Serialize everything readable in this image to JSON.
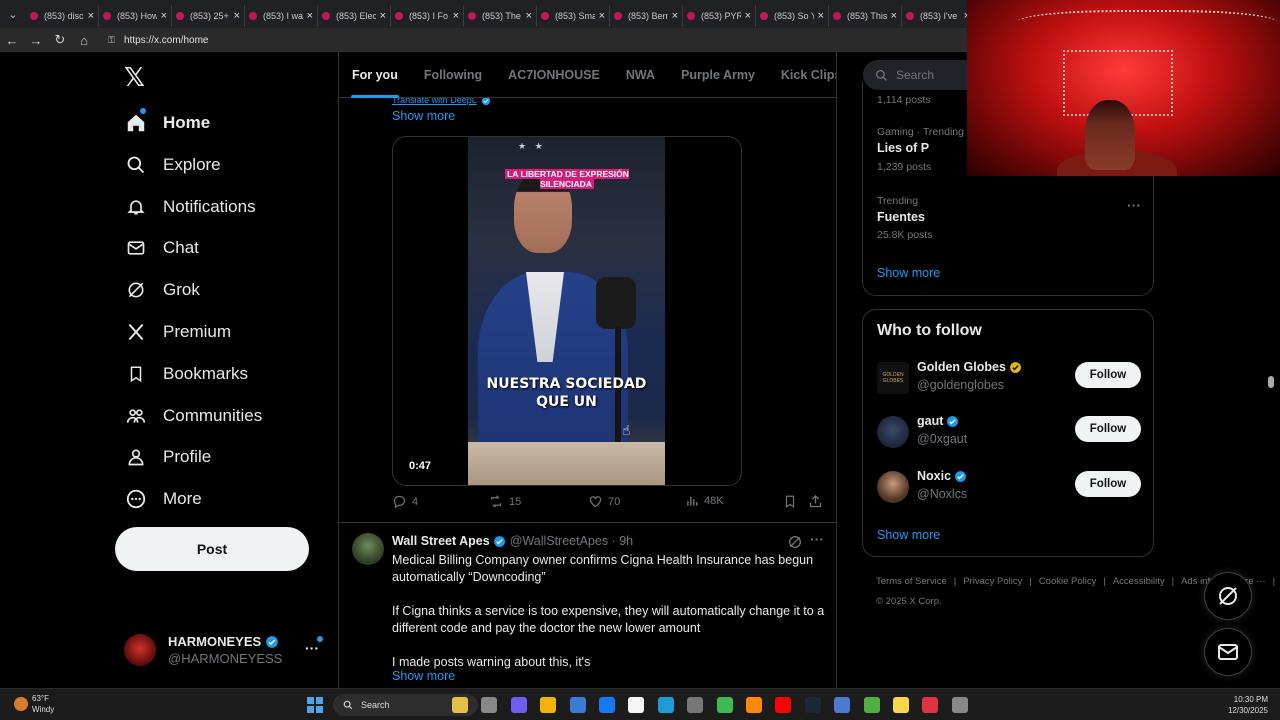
{
  "browser": {
    "tabs": [
      {
        "title": "(853) disc"
      },
      {
        "title": "(853) How"
      },
      {
        "title": "(853) 25+"
      },
      {
        "title": "(853) I wa"
      },
      {
        "title": "(853) Elec"
      },
      {
        "title": "(853) I Fo"
      },
      {
        "title": "(853) The"
      },
      {
        "title": "(853) Sma"
      },
      {
        "title": "(853) Bern"
      },
      {
        "title": "(853) PYR"
      },
      {
        "title": "(853) So Y"
      },
      {
        "title": "(853) This"
      },
      {
        "title": "(853) I've"
      }
    ],
    "tab_close": "×",
    "url": "https://x.com/home"
  },
  "nav": {
    "logo": "𝕏",
    "items": [
      {
        "label": "Home",
        "icon": "home-icon"
      },
      {
        "label": "Explore",
        "icon": "search-icon"
      },
      {
        "label": "Notifications",
        "icon": "bell-icon"
      },
      {
        "label": "Chat",
        "icon": "mail-icon"
      },
      {
        "label": "Grok",
        "icon": "grok-icon"
      },
      {
        "label": "Premium",
        "icon": "x-icon"
      },
      {
        "label": "Bookmarks",
        "icon": "bookmark-icon"
      },
      {
        "label": "Communities",
        "icon": "people-icon"
      },
      {
        "label": "Profile",
        "icon": "person-icon"
      },
      {
        "label": "More",
        "icon": "more-circle-icon"
      }
    ],
    "post_label": "Post",
    "account": {
      "display_name": "HARMONEYES",
      "handle": "@HARMONEYESS",
      "more": "···"
    }
  },
  "feed": {
    "tabs": [
      "For you",
      "Following",
      "AC7IONHOUSE",
      "NWA",
      "Purple Army",
      "Kick Clips"
    ],
    "tweet1": {
      "translate": "Translate with DeepL",
      "show_more": "Show more",
      "video": {
        "caption_top": "LA LIBERTAD DE EXPRESIÓN SILENCIADA",
        "stars": "★  ★",
        "subtitle_line1": "NUESTRA SOCIEDAD",
        "subtitle_line2": "QUE UN",
        "duration": "0:47"
      },
      "stats": {
        "replies": "4",
        "reposts": "15",
        "likes": "70",
        "views": "48K"
      }
    },
    "tweet2": {
      "name": "Wall Street Apes",
      "handle": "@WallStreetApes · 9h",
      "more": "···",
      "paragraphs": [
        "Medical Billing Company owner confirms Cigna Health Insurance has begun automatically “Downcoding”",
        "If Cigna thinks a service is too expensive, they will automatically change it to a different code and pay the doctor the new lower amount",
        "I made posts warning about this, it's"
      ],
      "show_more": "Show more"
    }
  },
  "sidebar": {
    "search_placeholder": "Search",
    "trends": [
      {
        "meta": "",
        "name": "",
        "posts": "1,114 posts"
      },
      {
        "meta": "Gaming · Trending",
        "name": "Lies of P",
        "posts": "1,239 posts"
      },
      {
        "meta": "Trending",
        "name": "Fuentes",
        "posts": "25.8K posts"
      }
    ],
    "trend_more": "···",
    "trends_show_more": "Show more",
    "who_to_follow": {
      "title": "Who to follow",
      "accounts": [
        {
          "name": "Golden Globes",
          "handle": "@goldenglobes",
          "button": "Follow",
          "badge": "gold"
        },
        {
          "name": "gaut",
          "handle": "@0xgaut",
          "button": "Follow",
          "badge": "blue"
        },
        {
          "name": "Noxic",
          "handle": "@Noxlcs",
          "button": "Follow",
          "badge": "blue"
        }
      ],
      "show_more": "Show more"
    },
    "footer": [
      "Terms of Service",
      "|",
      "Privacy Policy",
      "|",
      "Cookie Policy",
      "|",
      "Accessibility",
      "|",
      "Ads info",
      "|",
      "More ···",
      "|",
      "© 2025 X Corp."
    ],
    "golden_globes_logo": "GOLDEN GLOBES"
  },
  "taskbar": {
    "weather_temp": "63°F",
    "weather_desc": "Windy",
    "search_label": "Search",
    "time": "10:30 PM",
    "date": "12/30/2025",
    "icons": [
      "files-icon",
      "task-view-icon",
      "copilot-icon",
      "folder-icon",
      "store-icon",
      "facebook-icon",
      "amazon-icon",
      "edge-icon",
      "calculator-icon",
      "chrome-icon",
      "vlc-icon",
      "youtube-icon",
      "steam-icon",
      "app-icon",
      "xbox-icon",
      "sticky-notes-icon",
      "snipping-icon",
      "obs-icon"
    ]
  },
  "colors": {
    "accent": "#1d9bf0",
    "background": "#000000",
    "text": "#e7e9ea",
    "muted": "#71767b",
    "border": "#2f3336"
  }
}
